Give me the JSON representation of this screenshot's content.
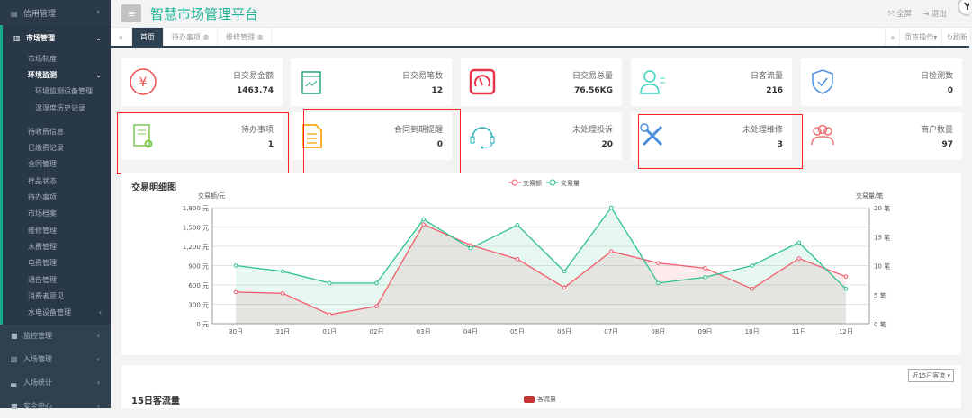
{
  "sidebar": {
    "top": {
      "label": "信用管理"
    },
    "market": {
      "label": "市场管理",
      "items": [
        {
          "label": "市场制度",
          "level": 1
        },
        {
          "label": "环境监测",
          "level": 1,
          "active": true,
          "expanded": true
        },
        {
          "label": "环境监测设备管理",
          "level": 2
        },
        {
          "label": "温湿度历史记录",
          "level": 2
        },
        {
          "label": "待收费信息",
          "level": 1
        },
        {
          "label": "已缴费记录",
          "level": 1
        },
        {
          "label": "合同管理",
          "level": 1
        },
        {
          "label": "样品状态",
          "level": 1
        },
        {
          "label": "待办事项",
          "level": 1
        },
        {
          "label": "市场档案",
          "level": 1
        },
        {
          "label": "维修管理",
          "level": 1
        },
        {
          "label": "水费管理",
          "level": 1
        },
        {
          "label": "电费管理",
          "level": 1
        },
        {
          "label": "通告管理",
          "level": 1
        },
        {
          "label": "消费者意见",
          "level": 1
        },
        {
          "label": "水电设备管理",
          "level": 1,
          "chevron": true
        }
      ]
    },
    "bottom": [
      {
        "label": "监控管理",
        "icon": "video-icon"
      },
      {
        "label": "入场管理",
        "icon": "bank-icon"
      },
      {
        "label": "入场统计",
        "icon": "chart-icon"
      },
      {
        "label": "安全中心",
        "icon": "video-icon"
      }
    ]
  },
  "header": {
    "title": "智慧市场管理平台",
    "fullscreen": "全屏",
    "logout": "退出",
    "logo": "YC"
  },
  "tabs": {
    "items": [
      {
        "label": "首页",
        "active": true
      },
      {
        "label": "待办事项"
      },
      {
        "label": "维修管理"
      }
    ],
    "page_ops": "页签操作",
    "refresh": "刷新"
  },
  "cards": [
    {
      "label": "日交易金额",
      "value": "1463.74",
      "icon": "yuan-icon",
      "color": "#f05050"
    },
    {
      "label": "日交易笔数",
      "value": "12",
      "icon": "calendar-chart-icon",
      "color": "#27a87a"
    },
    {
      "label": "日交易总量",
      "value": "76.56KG",
      "icon": "gauge-icon",
      "color": "#e8334a"
    },
    {
      "label": "日客流量",
      "value": "216",
      "icon": "person-icon",
      "color": "#3ad4c0"
    },
    {
      "label": "日检测数",
      "value": "0",
      "icon": "shield-check-icon",
      "color": "#4a90e2"
    },
    {
      "label": "待办事项",
      "value": "1",
      "icon": "document-gear-icon",
      "color": "#7dc855"
    },
    {
      "label": "合同到期提醒",
      "value": "0",
      "icon": "document-icon",
      "color": "#f5b22a"
    },
    {
      "label": "未处理投诉",
      "value": "20",
      "icon": "headset-icon",
      "color": "#27b0b8"
    },
    {
      "label": "未处理维修",
      "value": "3",
      "icon": "wrench-icon",
      "color": "#4a90e2"
    },
    {
      "label": "商户数量",
      "value": "97",
      "icon": "users-icon",
      "color": "#f07070"
    }
  ],
  "chart_panel": {
    "title": "交易明细图"
  },
  "chart_data": {
    "type": "line",
    "categories": [
      "30日",
      "31日",
      "01日",
      "02日",
      "03日",
      "04日",
      "05日",
      "06日",
      "07日",
      "08日",
      "09日",
      "10日",
      "11日",
      "12日"
    ],
    "series": [
      {
        "name": "交易额",
        "axis": "left",
        "color": "#f25a6a",
        "values": [
          490,
          470,
          140,
          270,
          1540,
          1220,
          1000,
          560,
          1120,
          940,
          860,
          540,
          1010,
          730
        ]
      },
      {
        "name": "交易量",
        "axis": "right",
        "color": "#2ec28f",
        "values": [
          10,
          9,
          7,
          7,
          18,
          13,
          17,
          9,
          20,
          7,
          8,
          10,
          14,
          6
        ]
      }
    ],
    "ylabel_left": "交易额/元",
    "ylabel_right": "交易量/笔",
    "yleft": {
      "min": 0,
      "max": 1800,
      "ticks": [
        "0 元",
        "300 元",
        "600 元",
        "900 元",
        "1,200 元",
        "1,500 元",
        "1,800 元"
      ]
    },
    "yright": {
      "min": 0,
      "max": 20,
      "ticks": [
        "0 笔",
        "5 笔",
        "10 笔",
        "15 笔",
        "20 笔"
      ]
    },
    "legend": "top-center",
    "grid": true
  },
  "bottom_panel": {
    "title": "15日客流量",
    "select": "近15日客流",
    "legend": "客流量",
    "legend_color": "#c23531"
  }
}
